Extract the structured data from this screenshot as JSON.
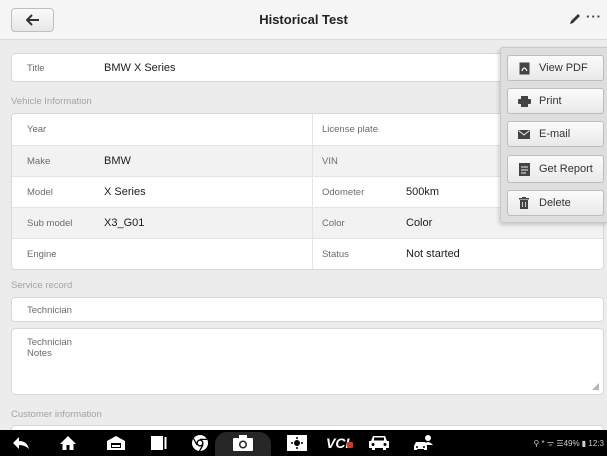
{
  "header": {
    "title": "Historical Test"
  },
  "title_field": {
    "label": "Title",
    "value": "BMW X Series"
  },
  "vehicle": {
    "heading": "Vehicle Information",
    "rows": [
      {
        "l_label": "Year",
        "l_value": "",
        "r_label": "License plate",
        "r_value": ""
      },
      {
        "l_label": "Make",
        "l_value": "BMW",
        "r_label": "VIN",
        "r_value": ""
      },
      {
        "l_label": "Model",
        "l_value": "X Series",
        "r_label": "Odometer",
        "r_value": "500km"
      },
      {
        "l_label": "Sub model",
        "l_value": "X3_G01",
        "r_label": "Color",
        "r_value": "Color"
      },
      {
        "l_label": "Engine",
        "l_value": "",
        "r_label": "Status",
        "r_value": "Not started"
      }
    ]
  },
  "service": {
    "heading": "Service record",
    "technician_label": "Technician",
    "notes_label_1": "Technician",
    "notes_label_2": "Notes"
  },
  "customer": {
    "heading": "Customer information"
  },
  "menu": {
    "items": [
      {
        "label": "View PDF",
        "icon": "pdf-icon"
      },
      {
        "label": "Print",
        "icon": "printer-icon"
      },
      {
        "label": "E-mail",
        "icon": "mail-icon"
      },
      {
        "label": "Get Report",
        "icon": "report-icon"
      },
      {
        "label": "Delete",
        "icon": "trash-icon"
      }
    ]
  },
  "navbar": {
    "vci_label": "VCI",
    "status_text": "⚲ * ᯤ ☰49% ▮ 12:3"
  }
}
